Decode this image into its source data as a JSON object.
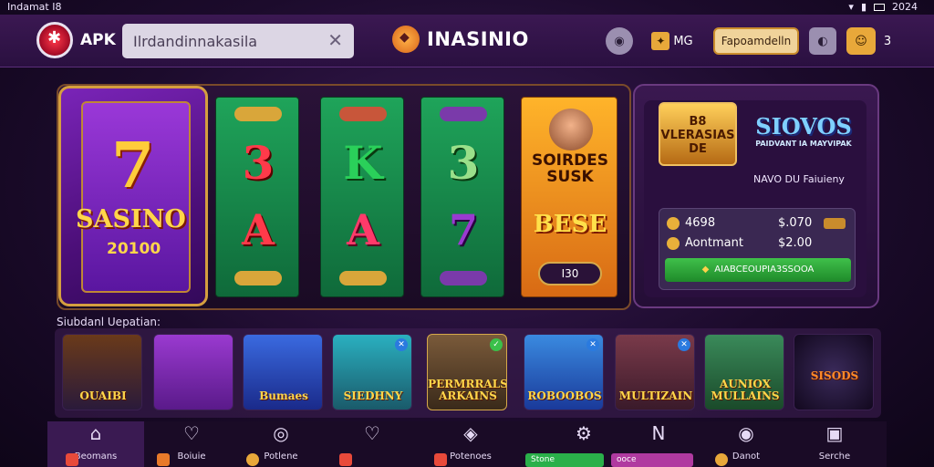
{
  "status": {
    "left": "Indamat I8",
    "right": "2024"
  },
  "header": {
    "app_label": "APK",
    "search_value": "Ilrdandinnakasila",
    "brand": "INASINIO",
    "btn_mg": "MG",
    "btn_promo": "Fapoamdelln",
    "btn_count": "3"
  },
  "feature": {
    "seven": "7",
    "name": "SASINO",
    "number": "20100"
  },
  "reels": [
    {
      "top": "3",
      "mid": "A",
      "color": "#ff3a4a"
    },
    {
      "top": "K",
      "mid": "A",
      "color": "#ff3a6a"
    },
    {
      "top": "3",
      "mid": "7",
      "color": "#7a3aaa"
    }
  ],
  "bonus": {
    "title": "SOIRDES SUSK",
    "big": "BESE",
    "pill": "I30"
  },
  "jackpot": {
    "badge_left": "B8 VLERASIAS DE",
    "badge_right": "SIOVOS",
    "badge_right_small": "PAIDVANT IA MAYVIPAK",
    "subtitle": "NAVO DU Faiuieny",
    "row1_label": "4698",
    "row1_value": "$.070",
    "row2_label": "Aontmant",
    "row2_value": "$2.00",
    "button": "AIABCEOUPIA3SSOOA"
  },
  "section_title": "Siubdanl Uepatian:",
  "games": [
    {
      "title": "OUAIBI",
      "bg": "#2a1a3a"
    },
    {
      "title": "",
      "bg": "#7a2ab0"
    },
    {
      "title": "Bumaes",
      "bg": "#2a4ac0"
    },
    {
      "title": "SIEDHNY",
      "bg": "#1a8a9a"
    },
    {
      "title": "PERMRRALS ARKAINS",
      "bg": "#5a3a22"
    },
    {
      "title": "ROBOOBOS",
      "bg": "#2a6ae0"
    },
    {
      "title": "MULTIZAIN",
      "bg": "#5a2a3a"
    },
    {
      "title": "AUNIOX MULLAINS",
      "bg": "#2a6a3a"
    },
    {
      "title": "SISODS",
      "bg": "#2a1a3a"
    }
  ],
  "nav": [
    {
      "label": "Beomans",
      "icon": "⌂"
    },
    {
      "label": "Boiuie",
      "icon": "♡"
    },
    {
      "label": "Potlene",
      "icon": "◎"
    },
    {
      "label": "",
      "icon": "♡"
    },
    {
      "label": "Potenoes",
      "icon": "◈"
    },
    {
      "label": "",
      "icon": "⚙"
    },
    {
      "label": "",
      "icon": "N"
    },
    {
      "label": "Danot",
      "icon": "◉"
    },
    {
      "label": "Serche",
      "icon": "▣"
    }
  ],
  "nav_pills": {
    "green": "Stone",
    "purple": "ooce"
  }
}
